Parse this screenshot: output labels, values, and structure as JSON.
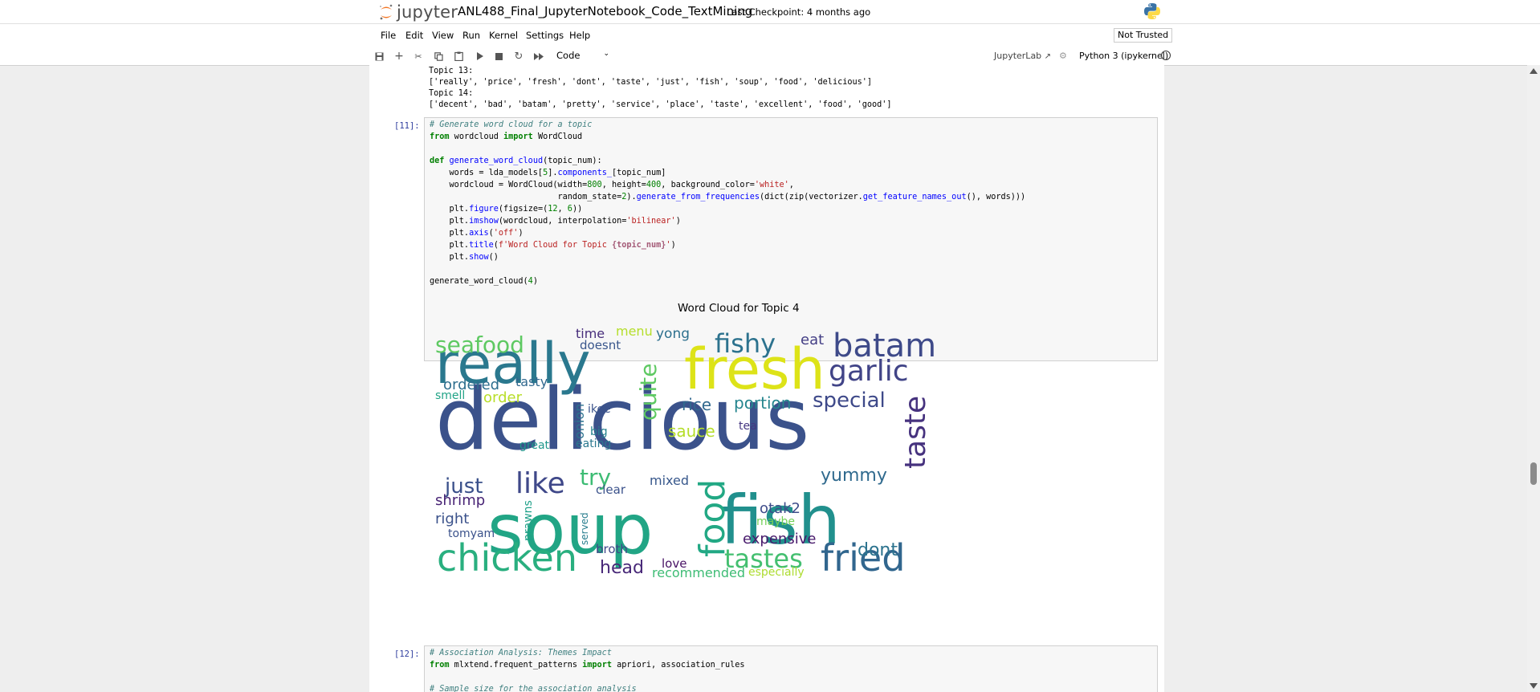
{
  "header": {
    "logo_text": "jupyter",
    "notebook_title": "ANL488_Final_JupyterNotebook_Code_TextMining",
    "checkpoint": "Last Checkpoint: 4 months ago"
  },
  "menu": [
    "File",
    "Edit",
    "View",
    "Run",
    "Kernel",
    "Settings",
    "Help"
  ],
  "not_trusted": "Not Trusted",
  "toolbar": {
    "cell_type": "Code",
    "jupyterlab_link": "JupyterLab",
    "kernel": "Python 3 (ipykernel)"
  },
  "output_top": {
    "lines": [
      "Topic 13:",
      "['really', 'price', 'fresh', 'dont', 'taste', 'just', 'fish', 'soup', 'food', 'delicious']",
      "Topic 14:",
      "['decent', 'bad', 'batam', 'pretty', 'service', 'place', 'taste', 'excellent', 'food', 'good']"
    ]
  },
  "cell11": {
    "prompt": "[11]:",
    "comment": "# Generate word cloud for a topic",
    "import_from": "from",
    "import_module": " wordcloud ",
    "import_kw": "import",
    "import_name": " WordCloud",
    "def_kw": "def",
    "def_name": "generate_word_cloud",
    "def_args": "(topic_num):",
    "line_words_1": "    words = lda_models[",
    "line_words_2": "5",
    "line_words_3": "].",
    "line_words_4": "components_",
    "line_words_5": "[topic_num]",
    "line_wc_1": "    wordcloud = WordCloud(width=",
    "line_wc_2": "800",
    "line_wc_3": ", height=",
    "line_wc_4": "400",
    "line_wc_5": ", background_color=",
    "line_wc_6": "'white'",
    "line_wc_7": ",",
    "line_rs_1": "                          random_state=",
    "line_rs_2": "2",
    "line_rs_3": ").",
    "line_rs_4": "generate_from_frequencies",
    "line_rs_5": "(dict(zip(vectorizer.",
    "line_rs_6": "get_feature_names_out",
    "line_rs_7": "(), words)))",
    "plt_figure_1": "    plt.",
    "plt_figure_2": "figure",
    "plt_figure_3": "(figsize=(",
    "plt_figure_4": "12",
    "plt_figure_5": ", ",
    "plt_figure_6": "6",
    "plt_figure_7": "))",
    "plt_imshow_1": "    plt.",
    "plt_imshow_2": "imshow",
    "plt_imshow_3": "(wordcloud, interpolation=",
    "plt_imshow_4": "'bilinear'",
    "plt_imshow_5": ")",
    "plt_axis_1": "    plt.",
    "plt_axis_2": "axis",
    "plt_axis_3": "(",
    "plt_axis_4": "'off'",
    "plt_axis_5": ")",
    "plt_title_1": "    plt.",
    "plt_title_2": "title",
    "plt_title_3": "(",
    "plt_title_4": "f'Word Cloud for Topic ",
    "plt_title_5": "{topic_num}",
    "plt_title_6": "'",
    "plt_title_7": ")",
    "plt_show_1": "    plt.",
    "plt_show_2": "show",
    "plt_show_3": "()",
    "call_1": "generate_word_cloud(",
    "call_2": "4",
    "call_3": ")"
  },
  "wordcloud_title": "Word Cloud for Topic 4",
  "cell12": {
    "prompt": "[12]:",
    "comment1": "# Association Analysis: Themes Impact",
    "from_kw": "from",
    "module": " mlxtend.frequent_patterns ",
    "import_kw": "import",
    "names": " apriori, association_rules",
    "comment2": "# Sample size for the association analysis"
  },
  "wordcloud_words": [
    {
      "t": "delicious",
      "s": 106,
      "c": "#3b528b"
    },
    {
      "t": "soup",
      "s": 86,
      "c": "#21a585"
    },
    {
      "t": "fish",
      "s": 84,
      "c": "#21908d"
    },
    {
      "t": "really",
      "s": 70,
      "c": "#2a788e"
    },
    {
      "t": "fresh",
      "s": 70,
      "c": "#dde318"
    },
    {
      "t": "chicken",
      "s": 46,
      "c": "#29af7f"
    },
    {
      "t": "fried",
      "s": 46,
      "c": "#31668e"
    },
    {
      "t": "batam",
      "s": 40,
      "c": "#3e4a89"
    },
    {
      "t": "taste",
      "s": 36,
      "c": "#46327e"
    },
    {
      "t": "garlic",
      "s": 36,
      "c": "#414487"
    },
    {
      "t": "like",
      "s": 36,
      "c": "#3f4889"
    },
    {
      "t": "fishy",
      "s": 32,
      "c": "#2c728e"
    },
    {
      "t": "food",
      "s": 44,
      "c": "#22a884"
    },
    {
      "t": "tastes",
      "s": 32,
      "c": "#44bf70"
    },
    {
      "t": "seafood",
      "s": 28,
      "c": "#5ec962"
    },
    {
      "t": "quite",
      "s": 28,
      "c": "#5ec962"
    },
    {
      "t": "try",
      "s": 28,
      "c": "#3dbc74"
    },
    {
      "t": "special",
      "s": 26,
      "c": "#3e4989"
    },
    {
      "t": "just",
      "s": 26,
      "c": "#3b518b"
    },
    {
      "t": "yummy",
      "s": 22,
      "c": "#306a8e"
    },
    {
      "t": "head",
      "s": 22,
      "c": "#482878"
    },
    {
      "t": "portion",
      "s": 20,
      "c": "#25858e"
    },
    {
      "t": "rice",
      "s": 20,
      "c": "#31688e"
    },
    {
      "t": "dont",
      "s": 22,
      "c": "#2c738e"
    },
    {
      "t": "otak2",
      "s": 18,
      "c": "#3e4c8a"
    },
    {
      "t": "shrimp",
      "s": 18,
      "c": "#482475"
    },
    {
      "t": "right",
      "s": 18,
      "c": "#3b528b"
    },
    {
      "t": "expensive",
      "s": 18,
      "c": "#481a6c"
    },
    {
      "t": "sauce",
      "s": 20,
      "c": "#b5de2b"
    },
    {
      "t": "mixed",
      "s": 16,
      "c": "#38588c"
    },
    {
      "t": "order",
      "s": 18,
      "c": "#b8de29"
    },
    {
      "t": "ordered",
      "s": 18,
      "c": "#2e6e8e"
    },
    {
      "t": "onion",
      "s": 16,
      "c": "#2c728e"
    },
    {
      "t": "broth",
      "s": 15,
      "c": "#404688"
    },
    {
      "t": "recommended",
      "s": 16,
      "c": "#3dbc74"
    },
    {
      "t": "especially",
      "s": 14,
      "c": "#addc30"
    },
    {
      "t": "love",
      "s": 15,
      "c": "#471164"
    },
    {
      "t": "clear",
      "s": 15,
      "c": "#3b528b"
    },
    {
      "t": "eat",
      "s": 18,
      "c": "#433e85"
    },
    {
      "t": "menu",
      "s": 16,
      "c": "#b5de2b"
    },
    {
      "t": "yong",
      "s": 17,
      "c": "#2d708e"
    },
    {
      "t": "time",
      "s": 16,
      "c": "#472d7b"
    },
    {
      "t": "tasty",
      "s": 16,
      "c": "#31688e"
    },
    {
      "t": "doesnt",
      "s": 15,
      "c": "#39568c"
    },
    {
      "t": "maybe",
      "s": 14,
      "c": "#73d056"
    },
    {
      "t": "prawns",
      "s": 14,
      "c": "#1fa088"
    },
    {
      "t": "tomyam",
      "s": 14,
      "c": "#3b528b"
    },
    {
      "t": "tea",
      "s": 14,
      "c": "#453781"
    },
    {
      "t": "big",
      "s": 14,
      "c": "#26828e"
    },
    {
      "t": "eating",
      "s": 14,
      "c": "#2a788e"
    },
    {
      "t": "great",
      "s": 14,
      "c": "#1f978b"
    },
    {
      "t": "smell",
      "s": 14,
      "c": "#20a386"
    },
    {
      "t": "served",
      "s": 12,
      "c": "#287d8e"
    },
    {
      "t": "ikee",
      "s": 14,
      "c": "#3a538b"
    }
  ]
}
